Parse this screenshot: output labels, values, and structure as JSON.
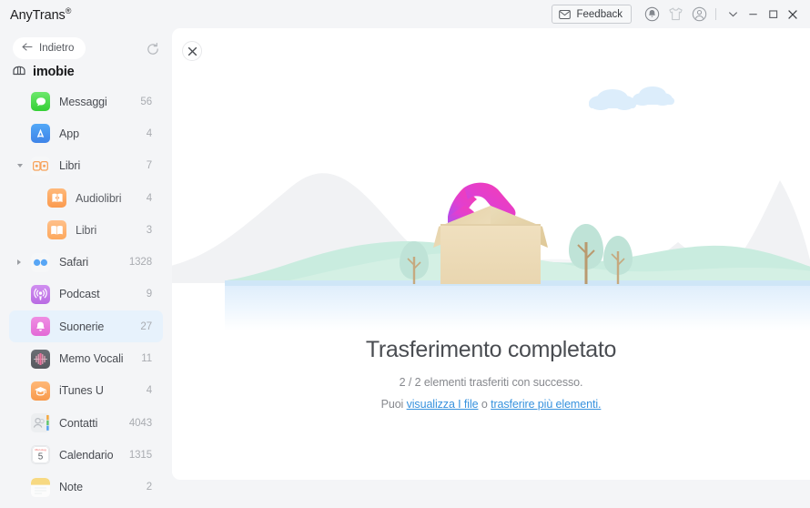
{
  "window": {
    "app_title": "AnyTrans",
    "app_title_mark": "®"
  },
  "titlebar": {
    "feedback_label": "Feedback",
    "icons": [
      {
        "name": "envelope-icon"
      },
      {
        "name": "bell-icon"
      },
      {
        "name": "tshirt-icon"
      },
      {
        "name": "account-icon"
      }
    ],
    "controls": [
      {
        "name": "chevron-down-icon"
      },
      {
        "name": "minimize-icon"
      },
      {
        "name": "maximize-icon"
      },
      {
        "name": "close-icon"
      }
    ]
  },
  "sidebar": {
    "back_label": "Indietro",
    "refresh_label": "refresh-icon",
    "device_name": "imobie",
    "items": [
      {
        "label": "Messaggi",
        "count": "56",
        "icon": "messages-icon",
        "level": 0,
        "arrow": "",
        "selected": false
      },
      {
        "label": "App",
        "count": "4",
        "icon": "appstore-icon",
        "level": 0,
        "arrow": "",
        "selected": false
      },
      {
        "label": "Libri",
        "count": "7",
        "icon": "books-group-icon",
        "level": 0,
        "arrow": "down",
        "selected": false
      },
      {
        "label": "Audiolibri",
        "count": "4",
        "icon": "audiobooks-icon",
        "level": 1,
        "arrow": "",
        "selected": false
      },
      {
        "label": "Libri",
        "count": "3",
        "icon": "books-icon",
        "level": 1,
        "arrow": "",
        "selected": false
      },
      {
        "label": "Safari",
        "count": "1328",
        "icon": "safari-group-icon",
        "level": 0,
        "arrow": "right",
        "selected": false
      },
      {
        "label": "Podcast",
        "count": "9",
        "icon": "podcast-icon",
        "level": 0,
        "arrow": "",
        "selected": false
      },
      {
        "label": "Suonerie",
        "count": "27",
        "icon": "ringtones-icon",
        "level": 0,
        "arrow": "",
        "selected": true
      },
      {
        "label": "Memo Vocali",
        "count": "11",
        "icon": "voicememos-icon",
        "level": 0,
        "arrow": "",
        "selected": false
      },
      {
        "label": "iTunes U",
        "count": "4",
        "icon": "itunesu-icon",
        "level": 0,
        "arrow": "",
        "selected": false
      },
      {
        "label": "Contatti",
        "count": "4043",
        "icon": "contacts-icon",
        "level": 0,
        "arrow": "",
        "selected": false
      },
      {
        "label": "Calendario",
        "count": "1315",
        "icon": "calendar-icon",
        "level": 0,
        "arrow": "",
        "selected": false
      },
      {
        "label": "Note",
        "count": "2",
        "icon": "notes-icon",
        "level": 0,
        "arrow": "",
        "selected": false
      }
    ]
  },
  "main": {
    "close_label": "close-icon",
    "illustration": "transfer-complete-illustration",
    "title": "Trasferimento completato",
    "subtitle": "2 / 2 elementi trasferiti con successo.",
    "links_prefix": "Puoi ",
    "link_view_files": "visualizza I file",
    "links_middle": " o ",
    "link_transfer_more": "trasferire più elementi.",
    "calendar_day": "5"
  },
  "colors": {
    "accent_link": "#3792de",
    "selected_row": "#e7f2fc",
    "chrome_bg": "#f4f5f7",
    "panel_bg": "#ffffff",
    "text_primary": "#4a4d52",
    "text_muted": "#87898e"
  }
}
